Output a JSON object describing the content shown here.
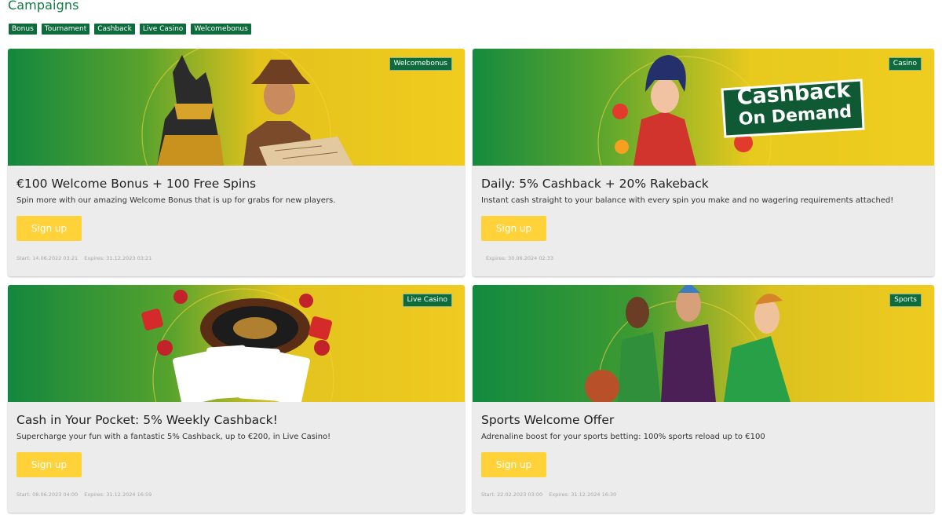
{
  "page_title": "Campaigns",
  "filters": [
    "Bonus",
    "Tournament",
    "Cashback",
    "Live Casino",
    "Welcomebonus"
  ],
  "colors": {
    "brand_green": "#0e6b3b",
    "button_yellow": "#ffd23a",
    "card_bg": "#ececec",
    "title_green": "#127a44"
  },
  "campaigns": [
    {
      "badge": "Welcomebonus",
      "banner_icon": "pharaoh-and-explorer-image",
      "title": "€100 Welcome Bonus + 100 Free Spins",
      "description": "Spin more with our amazing Welcome Bonus that is up for grabs for new players.",
      "button": "Sign up",
      "start": "Start: 14.06.2022 03:21",
      "expires": "Expires: 31.12.2023 03:21"
    },
    {
      "badge": "Casino",
      "banner_icon": "cashback-on-demand-image",
      "banner_text_line1": "Cashback",
      "banner_text_line2": "On Demand",
      "title": "Daily: 5% Cashback + 20% Rakeback",
      "description": "Instant cash straight to your balance with every spin you make and no wagering requirements attached!",
      "button": "Sign up",
      "start": "",
      "expires": "Expires: 30.06.2024 02:33"
    },
    {
      "badge": "Live Casino",
      "banner_icon": "roulette-cards-dice-image",
      "title": "Cash in Your Pocket: 5% Weekly Cashback!",
      "description": "Supercharge your fun with a fantastic 5% Cashback, up to €200, in Live Casino!",
      "button": "Sign up",
      "start": "Start: 08.06.2023 04:00",
      "expires": "Expires: 31.12.2024 16:59"
    },
    {
      "badge": "Sports",
      "banner_icon": "athletes-image",
      "title": "Sports Welcome Offer",
      "description": "Adrenaline boost for your sports betting: 100% sports reload up to €100",
      "button": "Sign up",
      "start": "Start: 22.02.2023 03:00",
      "expires": "Expires: 31.12.2024 16:30"
    }
  ]
}
